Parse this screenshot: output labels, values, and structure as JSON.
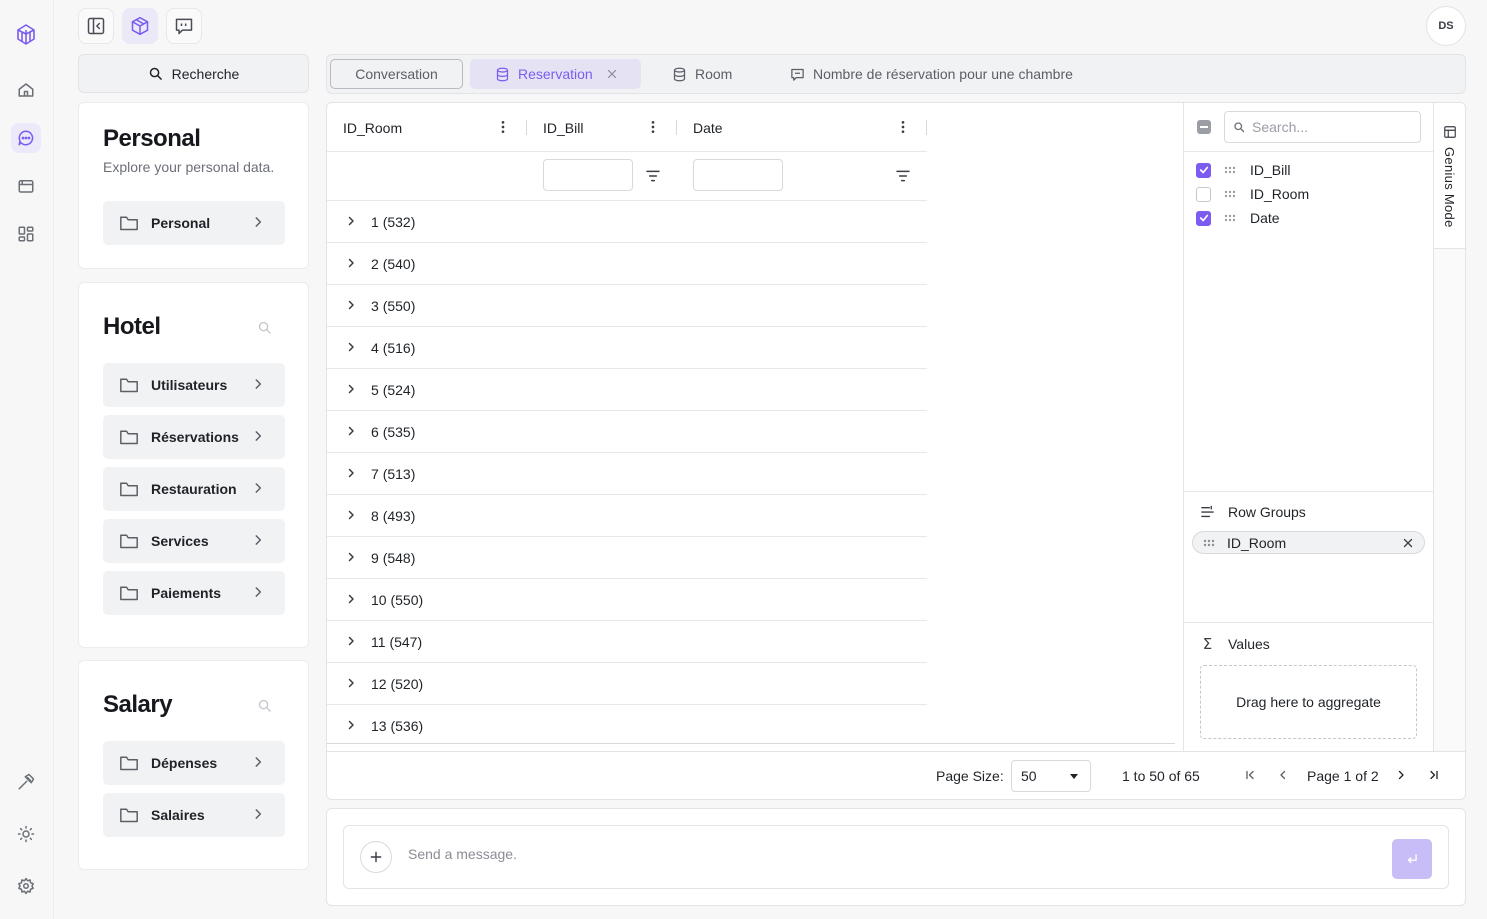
{
  "header": {
    "avatar_initials": "DS"
  },
  "left_panel": {
    "search_label": "Recherche",
    "sections": [
      {
        "title": "Personal",
        "subtitle": "Explore your personal data.",
        "folders": [
          "Personal"
        ]
      },
      {
        "title": "Hotel",
        "folders": [
          "Utilisateurs",
          "Réservations",
          "Restauration",
          "Services",
          "Paiements"
        ]
      },
      {
        "title": "Salary",
        "folders": [
          "Dépenses",
          "Salaires"
        ]
      }
    ]
  },
  "tabs": {
    "conversation": "Conversation",
    "reservation": "Reservation",
    "room": "Room",
    "nombre": "Nombre de réservation pour une chambre"
  },
  "grid": {
    "columns": [
      "ID_Room",
      "ID_Bill",
      "Date"
    ],
    "rows": [
      "1",
      "2",
      "3",
      "4",
      "5",
      "6",
      "7",
      "8",
      "9",
      "10",
      "11",
      "12",
      "13"
    ],
    "counts": [
      "(532)",
      "(540)",
      "(550)",
      "(516)",
      "(524)",
      "(535)",
      "(513)",
      "(493)",
      "(548)",
      "(550)",
      "(547)",
      "(520)",
      "(536)"
    ]
  },
  "tool_panel": {
    "search_placeholder": "Search...",
    "columns": [
      {
        "name": "ID_Bill",
        "checked": true
      },
      {
        "name": "ID_Room",
        "checked": false
      },
      {
        "name": "Date",
        "checked": true
      }
    ],
    "row_groups_label": "Row Groups",
    "row_group_item": "ID_Room",
    "values_label": "Values",
    "values_drop": "Drag here to aggregate",
    "genius_mode": "Genius Mode"
  },
  "pagination": {
    "page_size_label": "Page Size:",
    "page_size": "50",
    "range": "1 to 50 of 65",
    "page_prefix": "Page",
    "page_current": "1",
    "page_of": "of",
    "page_total": "2"
  },
  "chat": {
    "placeholder": "Send a message."
  },
  "colors": {
    "accent": "#7c5cf0",
    "send_button": "#c9bdf7"
  }
}
